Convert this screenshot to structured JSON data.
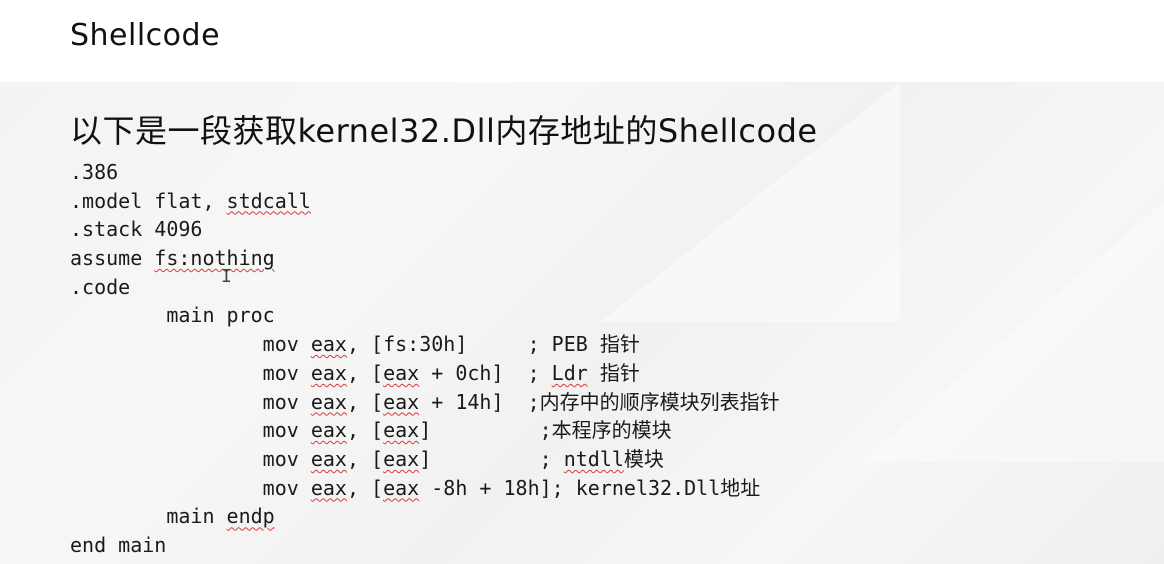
{
  "slide": {
    "title": "Shellcode",
    "subtitle": "以下是一段获取kernel32.Dll内存地址的Shellcode"
  },
  "code_lines": [
    [
      {
        "t": ".386"
      }
    ],
    [
      {
        "t": ".model flat, "
      },
      {
        "t": "stdcall",
        "squiggle": true
      }
    ],
    [
      {
        "t": ".stack 4096"
      }
    ],
    [
      {
        "t": "assume "
      },
      {
        "t": "fs:nothing",
        "squiggle": true
      }
    ],
    [
      {
        "t": ".code"
      }
    ],
    [
      {
        "t": "        main proc"
      }
    ],
    [
      {
        "t": "                mov "
      },
      {
        "t": "eax",
        "squiggle": true
      },
      {
        "t": ", [fs:30h]     ; PEB 指针"
      }
    ],
    [
      {
        "t": "                mov "
      },
      {
        "t": "eax",
        "squiggle": true
      },
      {
        "t": ", ["
      },
      {
        "t": "eax",
        "squiggle": true
      },
      {
        "t": " + 0ch]  ; "
      },
      {
        "t": "Ldr",
        "squiggle": true
      },
      {
        "t": " 指针"
      }
    ],
    [
      {
        "t": "                mov "
      },
      {
        "t": "eax",
        "squiggle": true
      },
      {
        "t": ", ["
      },
      {
        "t": "eax",
        "squiggle": true
      },
      {
        "t": " + 14h]  ;内存中的顺序模块列表指针"
      }
    ],
    [
      {
        "t": "                mov "
      },
      {
        "t": "eax",
        "squiggle": true
      },
      {
        "t": ", ["
      },
      {
        "t": "eax",
        "squiggle": true
      },
      {
        "t": "]         ;本程序的模块"
      }
    ],
    [
      {
        "t": "                mov "
      },
      {
        "t": "eax",
        "squiggle": true
      },
      {
        "t": ", ["
      },
      {
        "t": "eax",
        "squiggle": true
      },
      {
        "t": "]         ; "
      },
      {
        "t": "ntdll",
        "squiggle": true
      },
      {
        "t": "模块"
      }
    ],
    [
      {
        "t": "                mov "
      },
      {
        "t": "eax",
        "squiggle": true
      },
      {
        "t": ", ["
      },
      {
        "t": "eax",
        "squiggle": true
      },
      {
        "t": " -8h + 18h]; kernel32.Dll地址"
      }
    ],
    [
      {
        "t": "        main "
      },
      {
        "t": "endp",
        "squiggle": true
      }
    ],
    [
      {
        "t": "end main"
      }
    ]
  ],
  "colors": {
    "text": "#111111",
    "squiggle": "#d43c3c"
  }
}
